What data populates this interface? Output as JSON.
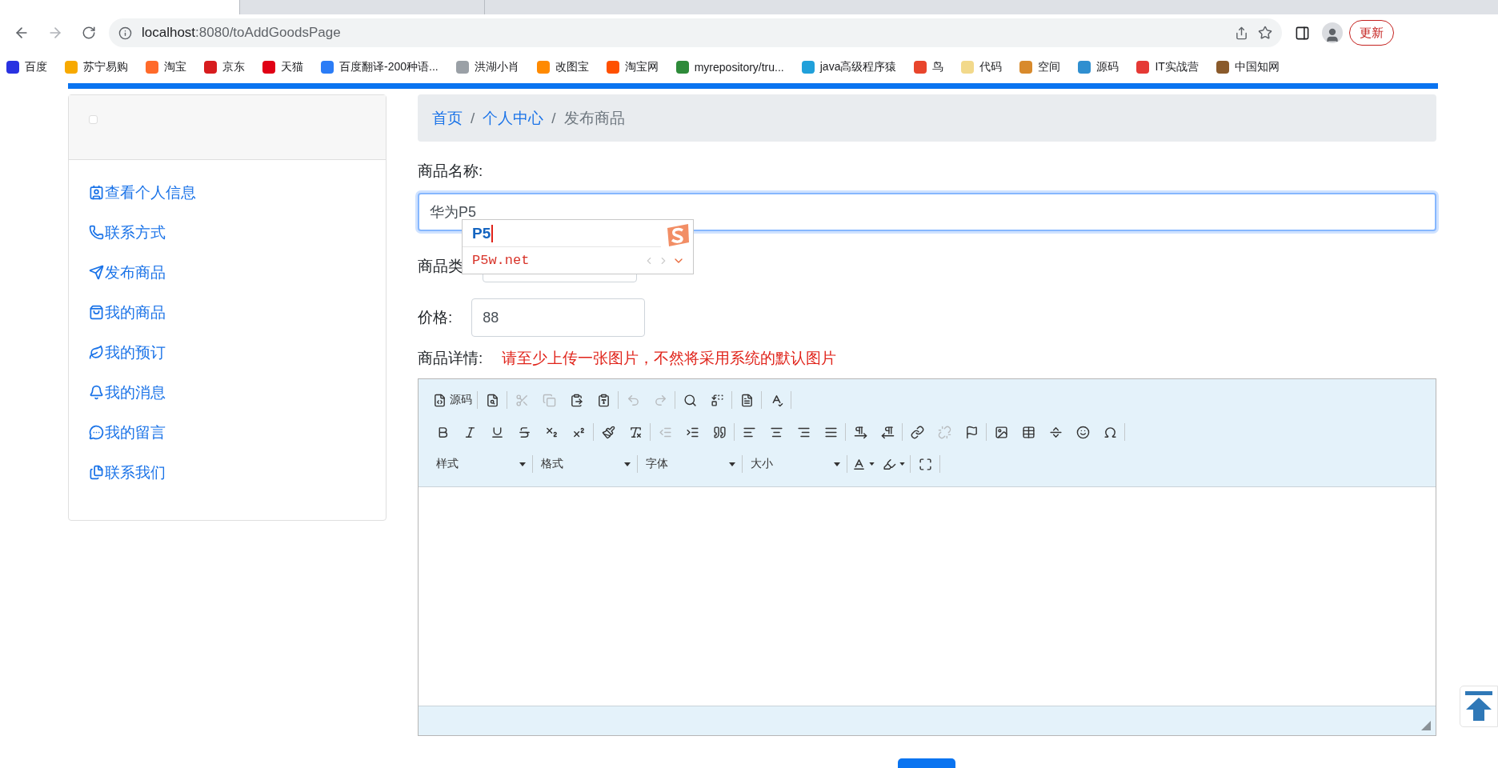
{
  "browser": {
    "tabs": [
      {
        "selected": true
      },
      {
        "selected": false
      }
    ],
    "url_host": "localhost",
    "url_path": ":8080/toAddGoodsPage",
    "update_button": "更新",
    "bookmarks": [
      {
        "label": "百度",
        "color": "#2932e1"
      },
      {
        "label": "苏宁易购",
        "color": "#f7a900"
      },
      {
        "label": "淘宝",
        "color": "#ff6a2a"
      },
      {
        "label": "京东",
        "color": "#d71c1e"
      },
      {
        "label": "天猫",
        "color": "#e00015"
      },
      {
        "label": "百度翻译-200种语...",
        "color": "#2b7cf6"
      },
      {
        "label": "洪湖小肖",
        "color": "#9aa0a6"
      },
      {
        "label": "改图宝",
        "color": "#ff8a00"
      },
      {
        "label": "淘宝网",
        "color": "#ff5000"
      },
      {
        "label": "myrepository/tru...",
        "color": "#2e8b3a"
      },
      {
        "label": "java高级程序猿",
        "color": "#20a0da"
      },
      {
        "label": "鸟",
        "color": "#e8452c"
      },
      {
        "label": "代码",
        "color": "#f2d98b"
      },
      {
        "label": "空间",
        "color": "#d88a2c"
      },
      {
        "label": "源码",
        "color": "#2f8fd0"
      },
      {
        "label": "IT实战营",
        "color": "#e53935"
      },
      {
        "label": "中国知网",
        "color": "#8a5a2b"
      }
    ]
  },
  "sidebar": {
    "header_checkbox": {
      "checked": false
    },
    "items": [
      {
        "kind": "id-card",
        "label": "查看个人信息"
      },
      {
        "kind": "phone",
        "label": "联系方式"
      },
      {
        "kind": "send",
        "label": "发布商品"
      },
      {
        "kind": "bag",
        "label": "我的商品"
      },
      {
        "kind": "leaf",
        "label": "我的预订"
      },
      {
        "kind": "bell",
        "label": "我的消息"
      },
      {
        "kind": "chat",
        "label": "我的留言"
      },
      {
        "kind": "files",
        "label": "联系我们"
      }
    ]
  },
  "breadcrumb": [
    {
      "label": "首页",
      "link": true
    },
    {
      "label": "个人中心",
      "link": true
    },
    {
      "label": "发布商品",
      "link": false
    }
  ],
  "separator": "/",
  "form": {
    "name_label": "商品名称:",
    "name_value": "华为P5",
    "category_label": "商品类",
    "price_label": "价格:",
    "price_value": "88",
    "details_label": "商品详情:",
    "details_hint": "请至少上传一张图片，不然将采用系统的默认图片"
  },
  "ime": {
    "composition": "P5",
    "candidate": "P5w.net"
  },
  "editor": {
    "rows": [
      [
        [
          {
            "kind": "source",
            "label": "源码",
            "disabled": false
          }
        ],
        [
          {
            "kind": "preview",
            "disabled": false
          }
        ],
        [
          {
            "kind": "cut",
            "disabled": true
          },
          {
            "kind": "copy",
            "disabled": true
          },
          {
            "kind": "paste",
            "disabled": false
          },
          {
            "kind": "paste-text",
            "disabled": false
          }
        ],
        [
          {
            "kind": "undo",
            "disabled": true
          },
          {
            "kind": "redo",
            "disabled": true
          }
        ],
        [
          {
            "kind": "find",
            "disabled": false
          },
          {
            "kind": "replace",
            "disabled": false
          }
        ],
        [
          {
            "kind": "select-all",
            "disabled": false
          }
        ],
        [
          {
            "kind": "spellcheck",
            "disabled": false
          }
        ]
      ],
      [
        [
          {
            "kind": "bold",
            "disabled": false
          },
          {
            "kind": "italic",
            "disabled": false
          },
          {
            "kind": "underline",
            "disabled": false
          },
          {
            "kind": "strike",
            "disabled": false
          },
          {
            "kind": "subscript",
            "disabled": false
          },
          {
            "kind": "superscript",
            "disabled": false
          }
        ],
        [
          {
            "kind": "copy-format",
            "disabled": false
          },
          {
            "kind": "remove-format",
            "disabled": false
          }
        ],
        [
          {
            "kind": "outdent",
            "disabled": true
          },
          {
            "kind": "indent",
            "disabled": false
          },
          {
            "kind": "blockquote",
            "disabled": false
          }
        ],
        [
          {
            "kind": "align-left",
            "disabled": false
          },
          {
            "kind": "align-center",
            "disabled": false
          },
          {
            "kind": "align-right",
            "disabled": false
          },
          {
            "kind": "align-justify",
            "disabled": false
          }
        ],
        [
          {
            "kind": "ltr",
            "disabled": false
          },
          {
            "kind": "rtl",
            "disabled": false
          }
        ],
        [
          {
            "kind": "link",
            "disabled": false
          },
          {
            "kind": "unlink",
            "disabled": true
          },
          {
            "kind": "anchor",
            "disabled": false
          }
        ],
        [
          {
            "kind": "image",
            "disabled": false
          },
          {
            "kind": "table",
            "disabled": false
          },
          {
            "kind": "hr",
            "disabled": false
          },
          {
            "kind": "smiley",
            "disabled": false
          },
          {
            "kind": "special-char",
            "disabled": false
          }
        ]
      ]
    ],
    "combos": [
      "样式",
      "格式",
      "字体",
      "大小"
    ],
    "color_tools": [
      {
        "kind": "text-color"
      },
      {
        "kind": "bg-color"
      }
    ]
  }
}
